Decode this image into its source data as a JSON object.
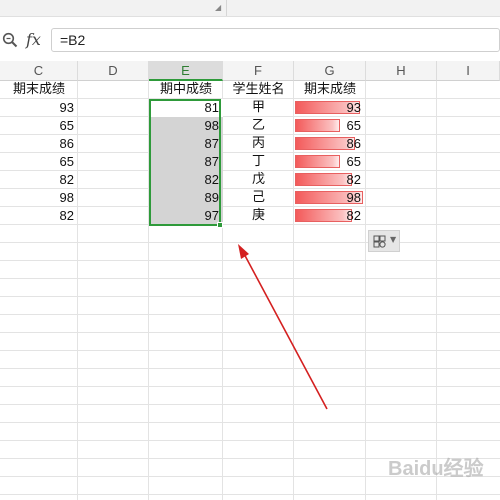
{
  "formula_bar": {
    "fx_label": "fx",
    "formula": "=B2"
  },
  "columns": [
    {
      "letter": "C"
    },
    {
      "letter": "D"
    },
    {
      "letter": "E",
      "selected": true
    },
    {
      "letter": "F"
    },
    {
      "letter": "G"
    },
    {
      "letter": "H"
    },
    {
      "letter": "I"
    }
  ],
  "sheet": {
    "headers": {
      "col_c": "期末成绩",
      "col_e": "期中成绩",
      "col_f": "学生姓名",
      "col_g": "期末成绩"
    },
    "rows": [
      {
        "c": "93",
        "e": "81",
        "f": "甲",
        "g": "93",
        "g_value": 93
      },
      {
        "c": "65",
        "e": "98",
        "f": "乙",
        "g": "65",
        "g_value": 65
      },
      {
        "c": "86",
        "e": "87",
        "f": "丙",
        "g": "86",
        "g_value": 86
      },
      {
        "c": "65",
        "e": "87",
        "f": "丁",
        "g": "65",
        "g_value": 65
      },
      {
        "c": "82",
        "e": "82",
        "f": "戊",
        "g": "82",
        "g_value": 82
      },
      {
        "c": "98",
        "e": "89",
        "f": "己",
        "g": "98",
        "g_value": 98
      },
      {
        "c": "82",
        "e": "97",
        "f": "庚",
        "g": "82",
        "g_value": 82
      }
    ]
  },
  "data_bar": {
    "min": 0,
    "max": 98,
    "color": "#f35a5a"
  },
  "selection": {
    "range_column": "E",
    "fill_color": "#d4d4d4",
    "border_color": "#2e9a3a"
  },
  "icons": {
    "zoom": "magnifier-icon",
    "paste_options": "paste-options-icon"
  },
  "watermark": "Baidu经验",
  "annotation_arrow_color": "#d42020"
}
